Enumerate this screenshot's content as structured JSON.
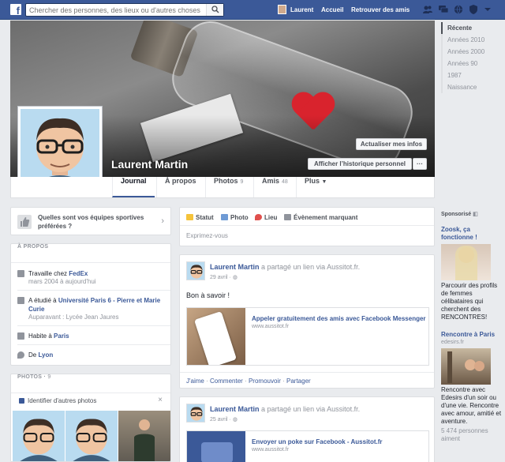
{
  "topbar": {
    "search_placeholder": "Chercher des personnes, des lieux ou d'autres choses",
    "user_name": "Laurent",
    "home_label": "Accueil",
    "find_friends_label": "Retrouver des amis",
    "icons": [
      "friend-requests-icon",
      "messages-icon",
      "notifications-icon",
      "privacy-shortcuts-icon"
    ]
  },
  "profile": {
    "name": "Laurent Martin",
    "update_info_label": "Actualiser mes infos",
    "activity_log_label": "Afficher l’historique personnel",
    "more_dots": "···"
  },
  "tabs": [
    {
      "label": "Journal",
      "count": ""
    },
    {
      "label": "À propos",
      "count": ""
    },
    {
      "label": "Photos",
      "count": "9"
    },
    {
      "label": "Amis",
      "count": "48"
    },
    {
      "label": "Plus",
      "count": ""
    }
  ],
  "timeline_nav": [
    "Récente",
    "Années 2010",
    "Années 2000",
    "Années 90",
    "1987",
    "Naissance"
  ],
  "sports_prompt": "Quelles sont vos équipes sportives préférées ?",
  "about": {
    "header": "À PROPOS",
    "work_prefix": "Travaille chez ",
    "work_place": "FedEx",
    "work_dates": "mars 2004 à aujourd'hui",
    "study_prefix": "A étudié à ",
    "study_place": "Université Paris 6 - Pierre et Marie Curie",
    "study_previous": "Auparavant : Lycée Jean Jaures",
    "lives_prefix": "Habite à ",
    "lives_place": "Paris",
    "from_prefix": "De ",
    "from_place": "Lyon"
  },
  "photos": {
    "header": "PHOTOS",
    "count": "9",
    "tag_label": "Identifier d'autres photos"
  },
  "composer": {
    "tabs": [
      "Statut",
      "Photo",
      "Lieu",
      "Évènement marquant"
    ],
    "placeholder": "Exprimez-vous"
  },
  "posts": [
    {
      "author": "Laurent Martin",
      "action": " a partagé un lien via Aussitot.fr.",
      "time": "29 avril",
      "text": "Bon à savoir !",
      "link_title": "Appeler gratuitement des amis avec Facebook Messenger",
      "link_domain": "www.aussitot.fr",
      "actions": [
        "J'aime",
        "Commenter",
        "Promouvoir",
        "Partager"
      ]
    },
    {
      "author": "Laurent Martin",
      "action": " a partagé un lien via Aussitot.fr.",
      "time": "25 avril",
      "link_title": "Envoyer un poke sur Facebook - Aussitot.fr",
      "link_domain": "www.aussitot.fr"
    }
  ],
  "ads": {
    "header": "Sponsorisé",
    "items": [
      {
        "title": "Zoosk, ça fonctionne !",
        "text": "Parcourir des profils de femmes célibataires qui cherchent des RENCONTRES!"
      },
      {
        "title": "Rencontre à Paris",
        "subtitle": "edesirs.fr",
        "text": "Rencontre avec Edesirs d'un soir ou d'une vie. Rencontre avec amour, amitié et aventure.",
        "likes": "5 474 personnes aiment"
      }
    ]
  }
}
